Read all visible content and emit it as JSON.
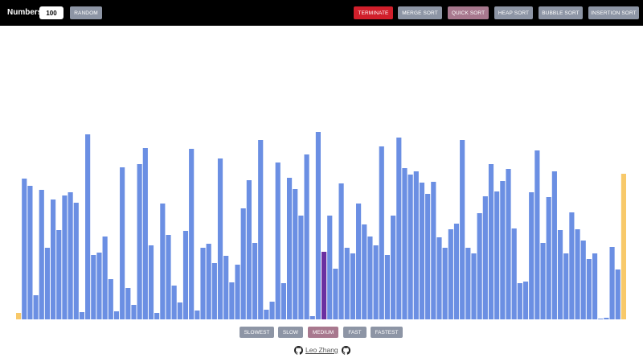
{
  "toolbar": {
    "numbers_label": "Numbers:",
    "numbers_value": "100",
    "random_label": "RANDOM",
    "terminate_label": "TERMINATE",
    "merge_label": "MERGE SORT",
    "quick_label": "QUICK SORT",
    "heap_label": "HEAP SORT",
    "bubble_label": "BUBBLE SORT",
    "insertion_label": "INSERTION SORT",
    "active_algorithm": "QUICK SORT"
  },
  "speed": {
    "slowest": "SLOWEST",
    "slow": "SLOW",
    "medium": "MEDIUM",
    "fast": "FAST",
    "fastest": "FASTEST",
    "selected": "MEDIUM"
  },
  "footer": {
    "author": "Leo Zhang",
    "github_icon": "github-icon"
  },
  "colors": {
    "bar": "#6b8fe3",
    "bar_pivot": "#f8c96a",
    "bar_compare": "#6b2fa0",
    "terminate": "#d11f2b",
    "active": "#a8788e",
    "button": "#8d95a5"
  },
  "bars": {
    "values": [
      8,
      175,
      166,
      30,
      161,
      89,
      149,
      111,
      154,
      158,
      145,
      9,
      230,
      80,
      83,
      103,
      50,
      10,
      189,
      39,
      18,
      193,
      213,
      92,
      8,
      144,
      105,
      42,
      21,
      110,
      212,
      11,
      89,
      94,
      70,
      200,
      79,
      46,
      68,
      138,
      173,
      95,
      223,
      12,
      22,
      195,
      45,
      176,
      162,
      129,
      205,
      4,
      233,
      84,
      129,
      63,
      169,
      89,
      82,
      144,
      118,
      103,
      92,
      215,
      80,
      129,
      226,
      188,
      180,
      184,
      170,
      156,
      171,
      102,
      89,
      112,
      119,
      223,
      89,
      82,
      132,
      153,
      193,
      159,
      172,
      187,
      113,
      45,
      47,
      158,
      210,
      95,
      152,
      184,
      111,
      82,
      133,
      112,
      98,
      75,
      82,
      1,
      2,
      90,
      62,
      181
    ],
    "pivot_indices": [
      0,
      105
    ],
    "compare_index": 53,
    "max_value": 240
  }
}
